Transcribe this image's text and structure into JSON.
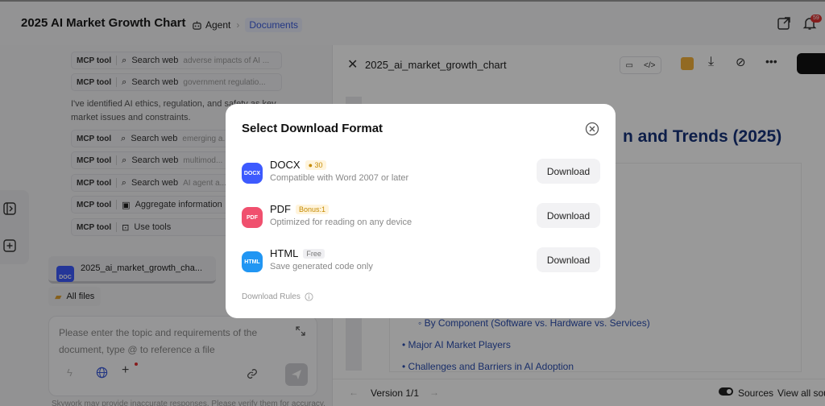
{
  "header": {
    "title": "2025 AI Market Growth Chart",
    "breadcrumb_agent": "Agent",
    "breadcrumb_documents": "Documents",
    "notification_count": "59"
  },
  "chat": {
    "tools": [
      {
        "tag": "MCP tool",
        "action": "Search web",
        "query": "adverse impacts of AI ..."
      },
      {
        "tag": "MCP tool",
        "action": "Search web",
        "query": "government regulatio..."
      },
      {
        "tag": "MCP tool",
        "action": "Search web",
        "query": "emerging a..."
      },
      {
        "tag": "MCP tool",
        "action": "Search web",
        "query": "multimod..."
      },
      {
        "tag": "MCP tool",
        "action": "Search web",
        "query": "AI agent a..."
      },
      {
        "tag": "MCP tool",
        "action": "Aggregate information",
        "query": ""
      },
      {
        "tag": "MCP tool",
        "action": "Use tools",
        "query": ""
      }
    ],
    "message": "I've identified AI ethics, regulation, and safety as key market issues and constraints.",
    "file_card": {
      "badge": "DOC",
      "name": "2025_ai_market_growth_cha..."
    },
    "all_files": "All files",
    "input_placeholder": "Please enter the topic and requirements of the document, type @ to reference a file",
    "disclaimer": "Skywork may provide inaccurate responses. Please verify them for accuracy."
  },
  "doc": {
    "file_name": "2025_ai_market_growth_chart",
    "heading": "n and Trends (2025)",
    "items": [
      "By Component (Software vs. Hardware vs. Services)",
      "Major AI Market Players",
      "Challenges and Barriers in AI Adoption"
    ],
    "version": "Version 1/1",
    "sources": "Sources",
    "view_all": "View all sou"
  },
  "modal": {
    "title": "Select Download Format",
    "formats": [
      {
        "icon": "DOCX",
        "name": "DOCX",
        "tag": "30",
        "desc": "Compatible with Word 2007 or later",
        "button": "Download",
        "color": "#3d5afe"
      },
      {
        "icon": "PDF",
        "name": "PDF",
        "tag": "Bonus:1",
        "desc": "Optimized for reading on any device",
        "button": "Download",
        "color": "#f0506e"
      },
      {
        "icon": "HTML",
        "name": "HTML",
        "tag": "Free",
        "desc": "Save generated code only",
        "button": "Download",
        "color": "#2196f3"
      }
    ],
    "rules": "Download Rules"
  }
}
